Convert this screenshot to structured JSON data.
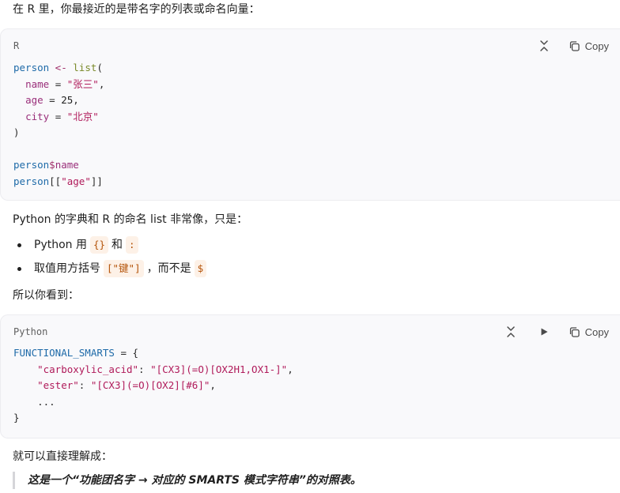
{
  "intro": "在 R 里，你最接近的是带名字的列表或命名向量：",
  "block1": {
    "lang": "R",
    "copy_label": "Copy",
    "code": {
      "l1_var": "person",
      "l1_op": " <- ",
      "l1_fn": "list",
      "l1_paren": "(",
      "l2_key": "name",
      "l2_eq": " = ",
      "l2_val": "\"张三\"",
      "l2_comma": ",",
      "l3_key": "age",
      "l3_eq": " = ",
      "l3_val": "25",
      "l3_comma": ",",
      "l4_key": "city",
      "l4_eq": " = ",
      "l4_val": "\"北京\"",
      "l5": ")",
      "l7_var": "person",
      "l7_dollar": "$",
      "l7_field": "name",
      "l8_var": "person",
      "l8_open": "[[",
      "l8_key": "\"age\"",
      "l8_close": "]]"
    }
  },
  "mid_text": "Python 的字典和 R 的命名 list 非常像，只是：",
  "bullets": {
    "b1_text": "Python 用",
    "b1_code1": "{}",
    "b1_and": "和",
    "b1_code2": ":",
    "b2_text": "取值用方括号",
    "b2_code1": "[\"键\"]",
    "b2_mid": "，而不是",
    "b2_code2": "$"
  },
  "see_text": "所以你看到：",
  "block2": {
    "lang": "Python",
    "copy_label": "Copy",
    "code": {
      "l1_name": "FUNCTIONAL_SMARTS",
      "l1_rest": " = {",
      "l2_key": "\"carboxylic_acid\"",
      "l2_colon": ": ",
      "l2_val": "\"[CX3](=O)[OX2H1,OX1-]\"",
      "l2_comma": ",",
      "l3_key": "\"ester\"",
      "l3_colon": ": ",
      "l3_val": "\"[CX3](=O)[OX2][#6]\"",
      "l3_comma": ",",
      "l4": "...",
      "l5": "}"
    }
  },
  "understand_text": "就可以直接理解成：",
  "quote": "这是一个“功能团名字 → 对应的 SMARTS 模式字符串”的对照表。"
}
